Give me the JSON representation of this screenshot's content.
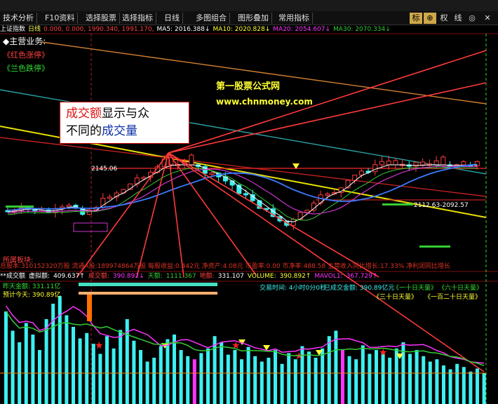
{
  "toolbar": {
    "buttons": [
      "技术分析",
      "F10资料",
      "选择股票",
      "选择指标",
      "日线",
      "多图组合",
      "图形叠加",
      "常用指标"
    ],
    "right_buttons": [
      "标",
      "⊕",
      "权",
      "线",
      "◎",
      "✕"
    ]
  },
  "quote": {
    "name": "上证指数",
    "period": "日线",
    "values": "0.000, 0.000, 1990.340, 1991.170,",
    "ma5": "MA5: 2016.388↓",
    "ma10": "MA10: 2020.828↓",
    "ma20": "MA20: 2054.607↓",
    "ma30": "MA30: 2070.334↓"
  },
  "main_panel": {
    "title": "◆主营业务:",
    "link_red": "《红色涨停》",
    "link_green": "《兰色跌停》",
    "price_label_high": "2145.06",
    "price_label_right": "2112.63-2092.57",
    "board_label": "所属板块:"
  },
  "callout": {
    "line1_red": "成交额",
    "line1_black": "显示与众",
    "line2_black": "不同的",
    "line2_blue": "成交量"
  },
  "watermark": {
    "cn": "第一股票公式网",
    "url": "www.chnmoney.com"
  },
  "info_line": "总股本:310152320万股  流通A股:189974864万股  每股收益:0.442元  净资产:4.08元  市盈率:0.00  市净率:488.58  主营收入同比增长:17.33%  净利润同比增长",
  "volume_panel": {
    "title": "**成交额",
    "virtual_label": "虚拟额:",
    "virtual_value": "409.637↑",
    "amount_label": "成交额:",
    "amount_value": "390.892↓",
    "day_label": "天额:",
    "day_value": "1111.367",
    "shrink_label": "地额:",
    "shrink_value": "331.107",
    "volume_label": "VOLUME:",
    "volume_value": "390.892↑",
    "mavol_label": "MAVOL1:",
    "mavol_value": "367.729↑",
    "yesterday": "昨天金额:  331.11亿",
    "estimate": "预计今天:  390.89亿",
    "trade_time": "交易时间:  4小时0分0秒",
    "done_amount": "已成交金额:  390.89亿元",
    "legend_1": "《一十日天量》",
    "legend_2": "《六十日天量》",
    "legend_3": "《三十日天量》",
    "legend_4": "《一百二十日天量》"
  },
  "chart_data": {
    "type": "candlestick+volume",
    "volume_values": [
      120,
      95,
      80,
      105,
      90,
      70,
      110,
      130,
      140,
      115,
      100,
      85,
      92,
      78,
      65,
      88,
      72,
      96,
      110,
      82,
      70,
      55,
      60,
      75,
      84,
      90,
      70,
      62,
      58,
      66,
      72,
      88,
      80,
      64,
      70,
      58,
      74,
      62,
      55,
      60,
      70,
      52,
      66,
      58,
      75,
      68,
      60,
      72,
      88,
      95,
      70,
      62,
      58,
      76,
      65,
      70,
      68,
      60,
      72,
      80,
      65,
      70,
      62,
      55,
      58,
      50,
      45,
      52,
      48,
      42,
      46,
      40
    ],
    "colors": {
      "up": "#ff3c3c",
      "down": "#3cf0f0",
      "ma5": "#ffffff",
      "ma10": "#ffff33",
      "ma20": "#ff33ff",
      "ma30": "#33cc33",
      "accent": "#ff3a3a"
    }
  }
}
